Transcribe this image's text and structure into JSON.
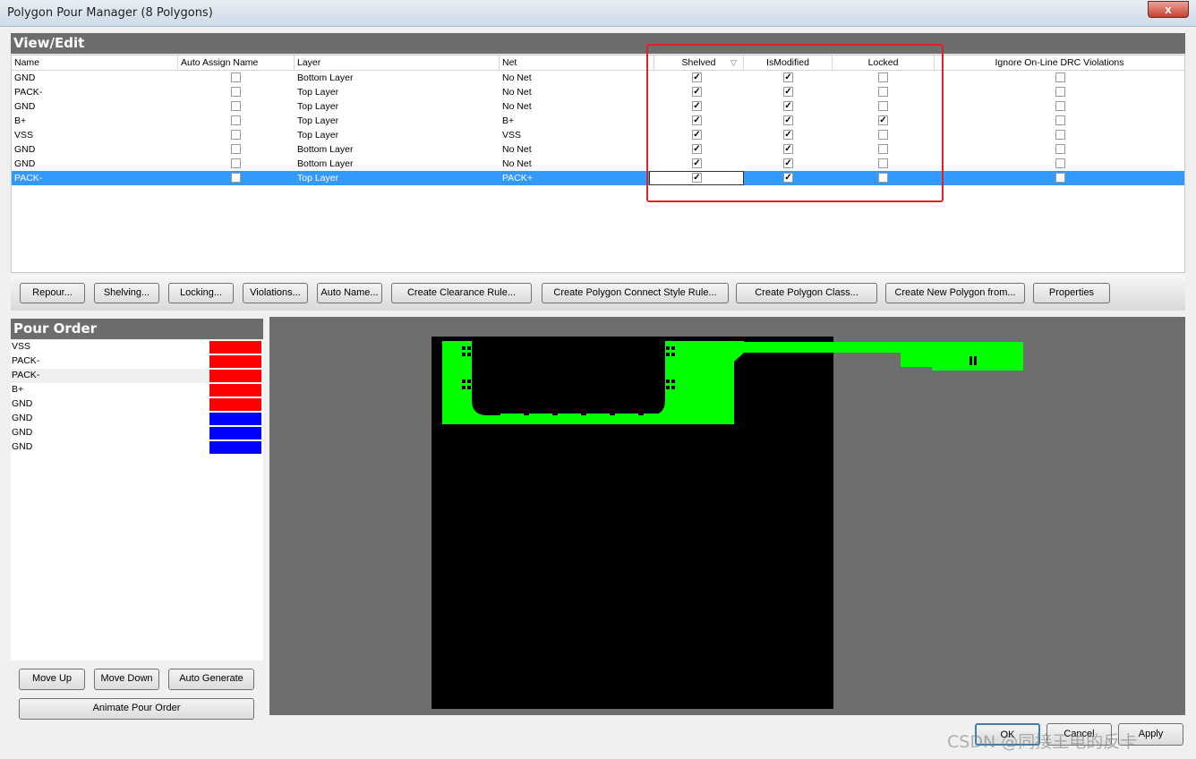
{
  "window": {
    "title": "Polygon Pour Manager (8 Polygons)",
    "close_glyph": "x"
  },
  "view_edit": {
    "header": "View/Edit",
    "columns": {
      "name": "Name",
      "auto_assign": "Auto Assign Name",
      "layer": "Layer",
      "net": "Net",
      "shelved": "Shelved",
      "is_modified": "IsModified",
      "locked": "Locked",
      "ignore_drc": "Ignore On-Line DRC Violations"
    },
    "sort_glyph": "▽",
    "rows": [
      {
        "name": "GND",
        "layer": "Bottom Layer",
        "net": "No Net",
        "auto": false,
        "shelved": true,
        "modified": true,
        "locked": false,
        "ignore": false
      },
      {
        "name": "PACK-",
        "layer": "Top Layer",
        "net": "No Net",
        "auto": false,
        "shelved": true,
        "modified": true,
        "locked": false,
        "ignore": false
      },
      {
        "name": "GND",
        "layer": "Top Layer",
        "net": "No Net",
        "auto": false,
        "shelved": true,
        "modified": true,
        "locked": false,
        "ignore": false
      },
      {
        "name": "B+",
        "layer": "Top Layer",
        "net": "B+",
        "auto": false,
        "shelved": true,
        "modified": true,
        "locked": true,
        "ignore": false
      },
      {
        "name": "VSS",
        "layer": "Top Layer",
        "net": "VSS",
        "auto": false,
        "shelved": true,
        "modified": true,
        "locked": false,
        "ignore": false
      },
      {
        "name": "GND",
        "layer": "Bottom Layer",
        "net": "No Net",
        "auto": false,
        "shelved": true,
        "modified": true,
        "locked": false,
        "ignore": false
      },
      {
        "name": "GND",
        "layer": "Bottom Layer",
        "net": "No Net",
        "auto": false,
        "shelved": true,
        "modified": true,
        "locked": false,
        "ignore": false
      },
      {
        "name": "PACK-",
        "layer": "Top Layer",
        "net": "PACK+",
        "auto": false,
        "shelved": true,
        "modified": true,
        "locked": false,
        "ignore": false,
        "selected": true
      }
    ],
    "check_glyph": "✓"
  },
  "toolbar": {
    "repour": "Repour...",
    "shelving": "Shelving...",
    "locking": "Locking...",
    "violations": "Violations...",
    "auto_name": "Auto Name...",
    "clearance_rule": "Create Clearance Rule...",
    "connect_style_rule": "Create Polygon Connect Style Rule...",
    "polygon_class": "Create Polygon Class...",
    "new_polygon_from": "Create New Polygon from...",
    "properties": "Properties"
  },
  "pour_order": {
    "header": "Pour Order",
    "items": [
      {
        "name": "VSS",
        "color": "#ff0000"
      },
      {
        "name": "PACK-",
        "color": "#ff0000"
      },
      {
        "name": "PACK-",
        "color": "#ff0000",
        "focused": true
      },
      {
        "name": "B+",
        "color": "#ff0000"
      },
      {
        "name": "GND",
        "color": "#ff0000"
      },
      {
        "name": "GND",
        "color": "#0000ff"
      },
      {
        "name": "GND",
        "color": "#0000ff"
      },
      {
        "name": "GND",
        "color": "#0000ff"
      }
    ],
    "move_up": "Move Up",
    "move_down": "Move Down",
    "auto_generate": "Auto Generate",
    "animate": "Animate Pour Order"
  },
  "preview": {
    "board_color": "#000000",
    "pour_color": "#00ff00",
    "background": "#6e6e6e"
  },
  "footer": {
    "ok": "OK",
    "cancel": "Cancel",
    "apply": "Apply"
  },
  "watermark": "CSDN @同接王电的反卡"
}
